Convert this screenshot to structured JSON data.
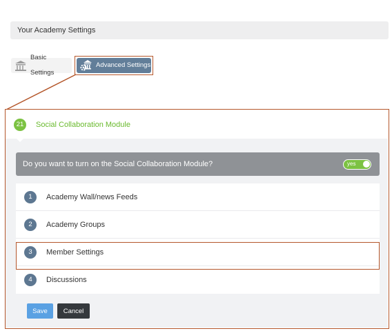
{
  "settings_bar": {
    "title": "Your Academy Settings"
  },
  "tabs": [
    {
      "label": "Basic Settings",
      "icon": "building-icon",
      "active": false
    },
    {
      "label": "Advanced Settings",
      "icon": "building-gear-icon",
      "active": true
    }
  ],
  "module": {
    "number": "21",
    "title": "Social Collaboration Module",
    "question": "Do you want to turn on the Social Collaboration Module?",
    "toggle_label": "yes",
    "toggle_on": true
  },
  "items": [
    {
      "number": "1",
      "label": "Academy Wall/news Feeds"
    },
    {
      "number": "2",
      "label": "Academy Groups"
    },
    {
      "number": "3",
      "label": "Member Settings"
    },
    {
      "number": "4",
      "label": "Discussions"
    }
  ],
  "buttons": {
    "save": "Save",
    "cancel": "Cancel"
  },
  "colors": {
    "accent_green": "#7cc242",
    "item_number_bg": "#5d7791",
    "active_tab_bg": "#627e99",
    "highlight": "#b4562a",
    "save_button": "#5aa1e3",
    "cancel_button": "#35393d"
  }
}
